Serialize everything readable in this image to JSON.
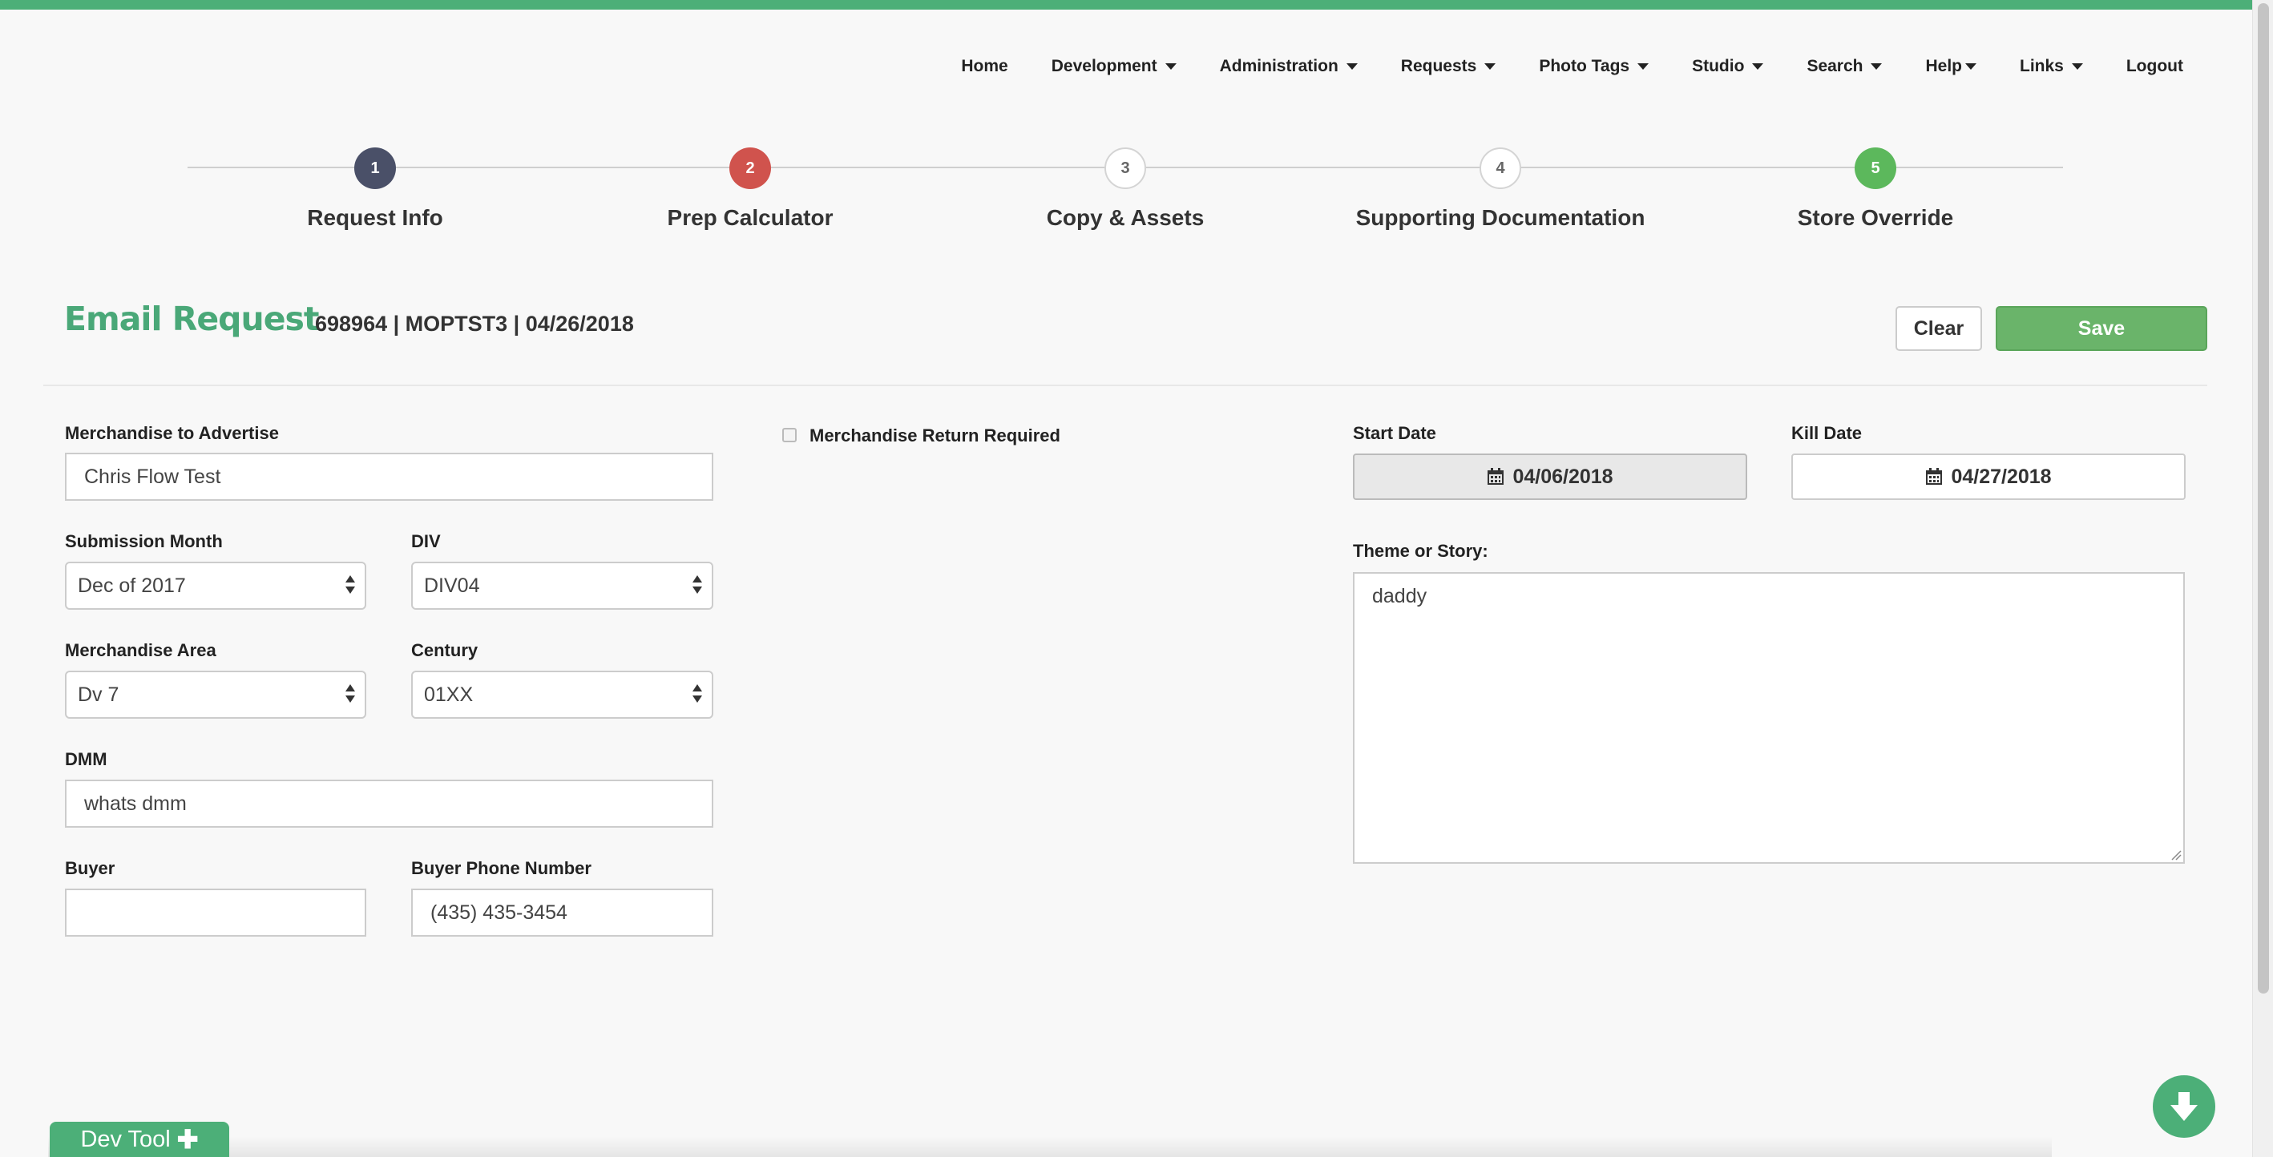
{
  "nav": {
    "items": [
      {
        "label": "Home",
        "dropdown": false
      },
      {
        "label": "Development",
        "dropdown": true
      },
      {
        "label": "Administration",
        "dropdown": true
      },
      {
        "label": "Requests",
        "dropdown": true
      },
      {
        "label": "Photo Tags",
        "dropdown": true
      },
      {
        "label": "Studio",
        "dropdown": true
      },
      {
        "label": "Search",
        "dropdown": true
      },
      {
        "label": "Help",
        "dropdown": true
      },
      {
        "label": "Links",
        "dropdown": true
      },
      {
        "label": "Logout",
        "dropdown": false
      }
    ]
  },
  "steps": [
    {
      "number": "1",
      "label": "Request Info",
      "state": "completed",
      "color": "#4a5068"
    },
    {
      "number": "2",
      "label": "Prep Calculator",
      "state": "error",
      "color": "#d0534d"
    },
    {
      "number": "3",
      "label": "Copy & Assets",
      "state": "pending",
      "color": "#ffffff"
    },
    {
      "number": "4",
      "label": "Supporting Documentation",
      "state": "pending",
      "color": "#ffffff"
    },
    {
      "number": "5",
      "label": "Store Override",
      "state": "complete",
      "color": "#5cb85c"
    }
  ],
  "header": {
    "title": "Email Request",
    "meta": "698964 | MOPTST3 | 04/26/2018",
    "clear_label": "Clear",
    "save_label": "Save"
  },
  "form": {
    "merchandise_label": "Merchandise to Advertise",
    "merchandise_value": "Chris Flow Test",
    "return_label": "Merchandise Return Required",
    "return_checked": false,
    "submission_month_label": "Submission Month",
    "submission_month_value": "Dec of 2017",
    "div_label": "DIV",
    "div_value": "DIV04",
    "merch_area_label": "Merchandise Area",
    "merch_area_value": "Dv 7",
    "century_label": "Century",
    "century_value": "01XX",
    "dmm_label": "DMM",
    "dmm_value": "whats dmm",
    "buyer_label": "Buyer",
    "buyer_value": "",
    "buyer_phone_label": "Buyer Phone Number",
    "buyer_phone_value": "(435) 435-3454",
    "start_date_label": "Start Date",
    "start_date_value": "04/06/2018",
    "kill_date_label": "Kill Date",
    "kill_date_value": "04/27/2018",
    "theme_label": "Theme or Story:",
    "theme_value": "daddy"
  },
  "footer": {
    "dev_tool_label": "Dev Tool",
    "dev_tool_icon": "plus-icon",
    "scroll_down_icon": "arrow-down-circle-icon"
  },
  "colors": {
    "accent": "#4caf78",
    "save": "#6ab46a"
  }
}
